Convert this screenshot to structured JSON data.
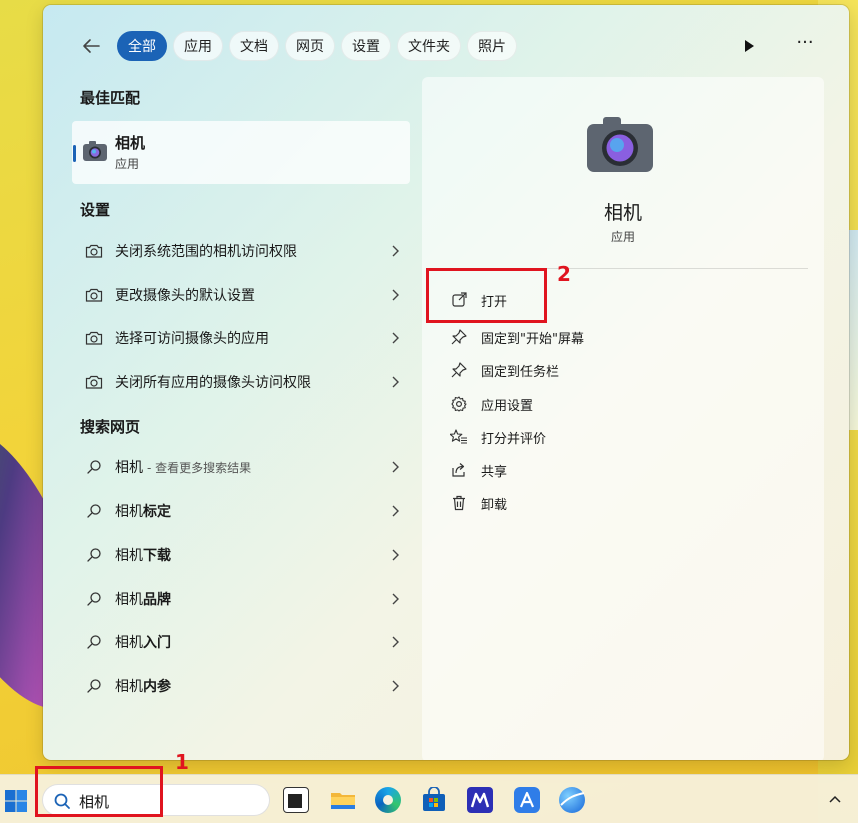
{
  "filters": [
    "全部",
    "应用",
    "文档",
    "网页",
    "设置",
    "文件夹",
    "照片"
  ],
  "best_match": {
    "title": "最佳匹配",
    "name": "相机",
    "type": "应用"
  },
  "settings": {
    "title": "设置",
    "items": [
      "关闭系统范围的相机访问权限",
      "更改摄像头的默认设置",
      "选择可访问摄像头的应用",
      "关闭所有应用的摄像头访问权限"
    ]
  },
  "web": {
    "title": "搜索网页",
    "first": {
      "query": "相机",
      "hint": "- 查看更多搜索结果"
    },
    "items": [
      {
        "prefix": "相机",
        "suffix": "标定"
      },
      {
        "prefix": "相机",
        "suffix": "下载"
      },
      {
        "prefix": "相机",
        "suffix": "品牌"
      },
      {
        "prefix": "相机",
        "suffix": "入门"
      },
      {
        "prefix": "相机",
        "suffix": "内参"
      }
    ]
  },
  "detail": {
    "name": "相机",
    "type": "应用",
    "actions": [
      "打开",
      "固定到\"开始\"屏幕",
      "固定到任务栏",
      "应用设置",
      "打分并评价",
      "共享",
      "卸载"
    ]
  },
  "annotations": {
    "one": "1",
    "two": "2"
  },
  "taskbar": {
    "search_value": "相机"
  },
  "colors": {
    "accent": "#1b63b6",
    "annotation": "#e0141f"
  }
}
